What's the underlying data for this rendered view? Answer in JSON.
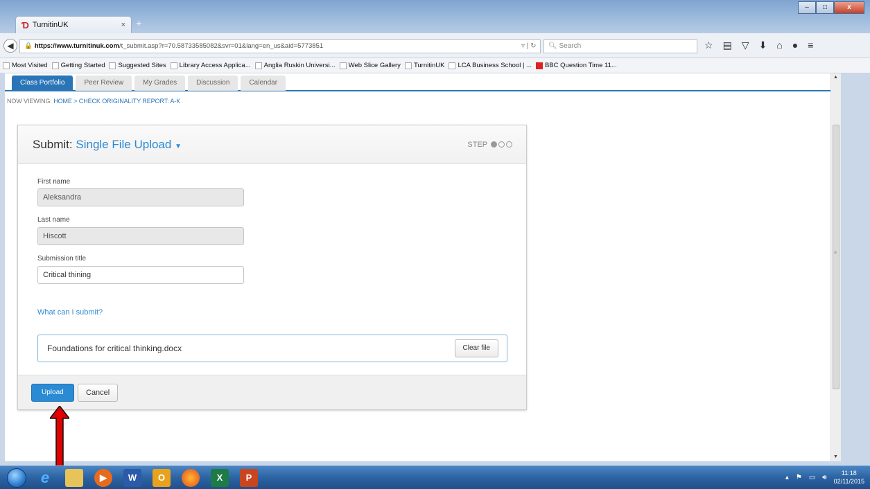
{
  "browser": {
    "tab_title": "TurnitinUK",
    "tab_close": "×",
    "new_tab": "+",
    "url_host": "https://www.turnitinuk.com",
    "url_path": "/t_submit.asp?r=70.58733585082&svr=01&lang=en_us&aid=5773851",
    "search_placeholder": "Search",
    "window_controls": [
      "–",
      "□",
      "x"
    ]
  },
  "bookmarks": [
    "Most Visited",
    "Getting Started",
    "Suggested Sites",
    "Library Access Applica...",
    "Anglia Ruskin Universi...",
    "Web Slice Gallery",
    "TurnitinUK",
    "LCA Business School | ...",
    "BBC Question Time 11..."
  ],
  "nav_tabs": [
    {
      "label": "Class Portfolio",
      "active": true
    },
    {
      "label": "Peer Review",
      "active": false
    },
    {
      "label": "My Grades",
      "active": false
    },
    {
      "label": "Discussion",
      "active": false
    },
    {
      "label": "Calendar",
      "active": false
    }
  ],
  "breadcrumb": {
    "prefix": "NOW VIEWING:",
    "home": "HOME",
    "separator": ">",
    "current": "CHECK ORIGINALITY REPORT: A-K"
  },
  "submit_panel": {
    "title": "Submit:",
    "type": "Single File Upload",
    "step_label": "STEP",
    "step_current": 1,
    "step_total": 3,
    "first_name_label": "First name",
    "first_name_value": "Aleksandra",
    "last_name_label": "Last name",
    "last_name_value": "Hiscott",
    "submission_title_label": "Submission title",
    "submission_title_value": "Critical thining",
    "help_link": "What can I submit?",
    "file_name": "Foundations for critical thinking.docx",
    "clear_button": "Clear file",
    "upload_button": "Upload",
    "cancel_button": "Cancel"
  },
  "annotation_color": "#e00000",
  "taskbar": {
    "time": "11:18",
    "date": "02/11/2015"
  }
}
